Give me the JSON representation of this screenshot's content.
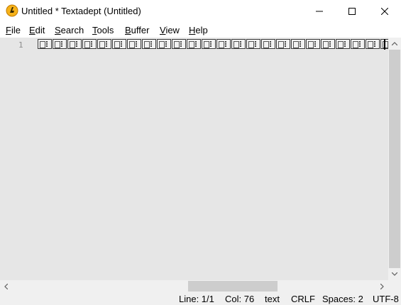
{
  "window": {
    "title": "Untitled * Textadept (Untitled)",
    "icon": "textadept-app-icon",
    "controls": {
      "minimize": "minimize-icon",
      "maximize": "maximize-icon",
      "close": "close-icon"
    }
  },
  "menu": {
    "items": [
      {
        "key": "F",
        "rest": "ile"
      },
      {
        "key": "E",
        "rest": "dit"
      },
      {
        "key": "S",
        "rest": "earch"
      },
      {
        "key": "T",
        "rest": "ools"
      },
      {
        "key": "B",
        "rest": "uffer"
      },
      {
        "key": "V",
        "rest": "iew"
      },
      {
        "key": "H",
        "rest": "elp"
      }
    ]
  },
  "editor": {
    "line_numbers": [
      "1"
    ],
    "glyph_count": 24,
    "glyph_icon": "missing-glyph-box-icon",
    "background": "#e6e6e6"
  },
  "scrollbars": {
    "vertical": {
      "up": "arrow-up-icon",
      "down": "arrow-down-icon"
    },
    "horizontal": {
      "left": "arrow-left-icon",
      "right": "arrow-right-icon"
    }
  },
  "status": {
    "line": "Line: 1/1",
    "col": "Col: 76",
    "lexer": "text",
    "eol": "CRLF",
    "indent": "Spaces: 2",
    "encoding": "UTF-8"
  },
  "colors": {
    "editor_bg": "#e6e6e6",
    "chrome_bg": "#f0f0f0",
    "scroll_thumb": "#cdcdcd",
    "line_number": "#8c8c8c"
  }
}
